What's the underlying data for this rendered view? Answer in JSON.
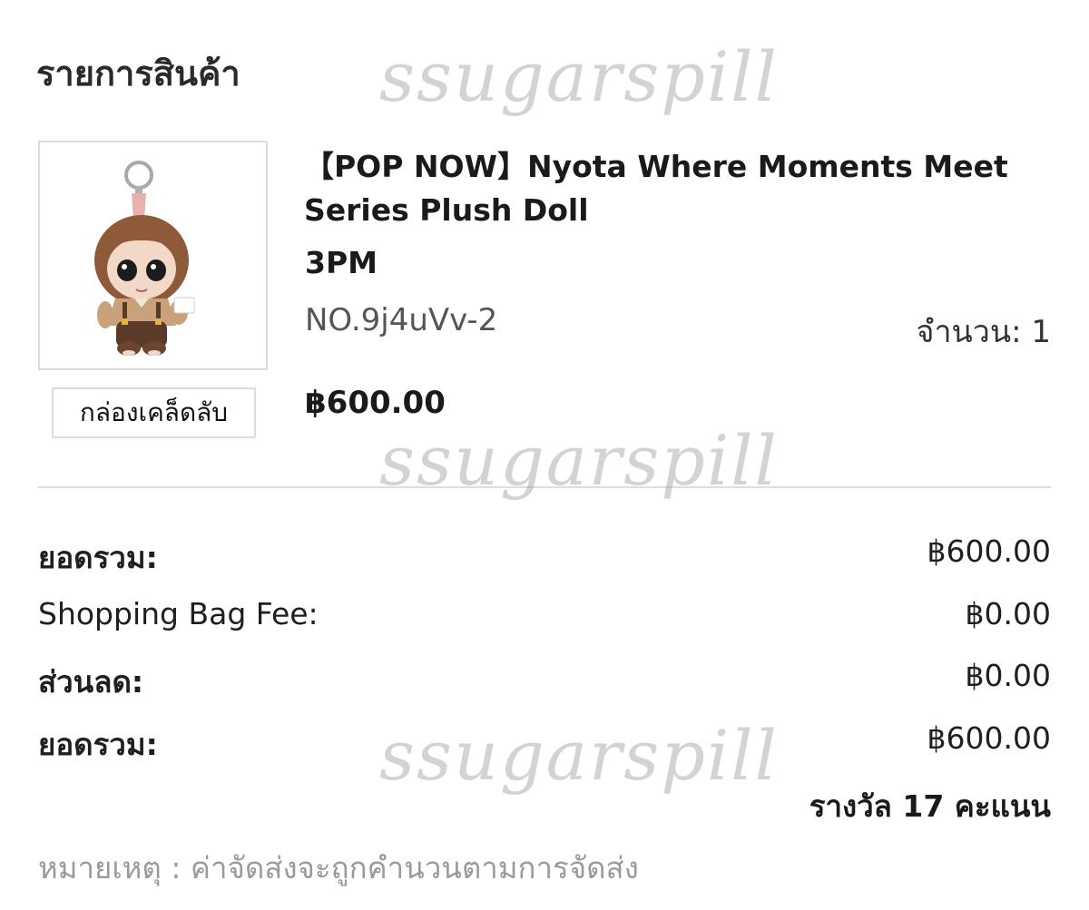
{
  "section": {
    "title": "รายการสินค้า"
  },
  "product": {
    "image_alt": "Nyota plush doll keychain",
    "name": "【POP NOW】Nyota Where Moments Meet Series Plush Doll",
    "variant": "3PM",
    "code": "NO.9j4uVv-2",
    "quantity_label": "จำนวน: 1",
    "price": "฿600.00",
    "mystery_box_label": "กล่องเคล็ดลับ"
  },
  "summary": {
    "subtotal_label": "ยอดรวม:",
    "subtotal_value": "฿600.00",
    "bag_fee_label": "Shopping Bag Fee:",
    "bag_fee_value": "฿0.00",
    "discount_label": "ส่วนลด:",
    "discount_value": "฿0.00",
    "total_label": "ยอดรวม:",
    "total_value": "฿600.00",
    "reward_text": "รางวัล 17 คะแนน"
  },
  "note": "หมายเหตุ : ค่าจัดส่งจะถูกคำนวนตามการจัดส่ง",
  "watermark": {
    "text": "ssugarspill"
  }
}
